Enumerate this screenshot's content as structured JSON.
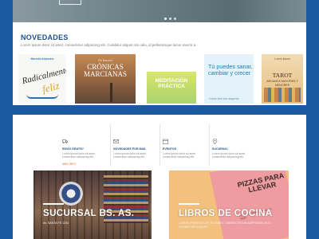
{
  "hero": {
    "dots": 3,
    "active_dot": 1
  },
  "novedades": {
    "title": "NOVEDADES",
    "lorem": "Lorem ipsum dolor sit amet, consectetur adipiscing elit. Curabitur aliquet nisi odio, id pellentesque lacus viverra a.",
    "books": [
      {
        "author": "Marcela Alejandra",
        "title_a": "Radicalmente",
        "title_b": "feliz"
      },
      {
        "author": "Rix Baronet",
        "title": "CRÓNICAS MARCIANAS"
      },
      {
        "title": "MEDITACIÓN PRÁCTICA"
      },
      {
        "title": "Tú puedes sanar, cambiar y crecer",
        "subtitle": "Cómo vivir tus mayores"
      },
      {
        "author": "Lorem ipsum",
        "title": "TAROT",
        "subtitle": "ARCANOS MAYORES Y MENORES"
      }
    ]
  },
  "features": [
    {
      "title": "ENVÍO GRATIS*",
      "desc": "Lorem ipsum dolor sit amet, consectetur adipiscing elit.",
      "link": "MÁS INFO"
    },
    {
      "title": "NOVEDADES POR MAIL",
      "desc": "Lorem ipsum dolor sit amet, consectetur adipiscing elit."
    },
    {
      "title": "EVENTOS",
      "desc": "Lorem ipsum dolor sit amet, consectetur adipiscing elit."
    },
    {
      "title": "SUCURSAL",
      "desc": "Lorem ipsum dolor sit amet, consectetur adipiscing elit."
    }
  ],
  "tiles": {
    "left": {
      "title": "SUCURSAL BS. AS.",
      "desc": "Av. SANTA FE 1234"
    },
    "right": {
      "title": "LIBROS DE COCINA",
      "desc": "LOREM IPSUM DOLOR SIT AMET, CONSECTETUR ADIPISCING ELIT. CURABITUR ALIQUET",
      "book_title": "PIZZAS PARA LLEVAR",
      "book_sub": "LOREM IPSUM DOLOR SIT AMET"
    }
  },
  "colors": {
    "background": "#1b5aa0",
    "heading": "#1b4f93",
    "link": "#e2692b"
  },
  "icons": [
    "truck-icon",
    "mail-icon",
    "calendar-icon",
    "location-pin-icon"
  ]
}
